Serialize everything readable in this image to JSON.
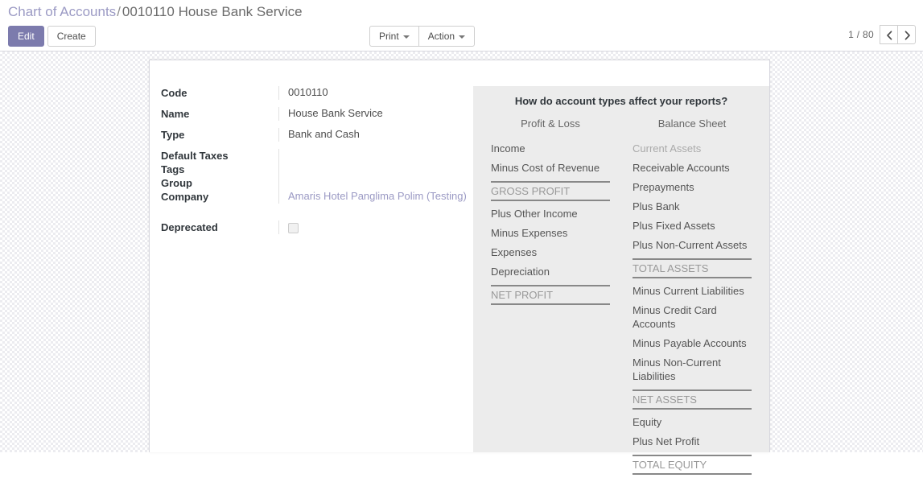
{
  "breadcrumb": {
    "root": "Chart of Accounts",
    "separator": "/",
    "current": "0010110 House Bank Service"
  },
  "toolbar": {
    "edit_label": "Edit",
    "create_label": "Create",
    "print_label": "Print",
    "action_label": "Action",
    "pager_count": "1 / 80",
    "previous_icon": "chevron-left-icon",
    "next_icon": "chevron-right-icon"
  },
  "form": {
    "fields": [
      {
        "label": "Code",
        "value": "0010110"
      },
      {
        "label": "Name",
        "value": "House Bank Service"
      },
      {
        "label": "Type",
        "value": "Bank and Cash"
      },
      {
        "label": "Default Taxes",
        "value": ""
      },
      {
        "label": "Tags",
        "value": ""
      },
      {
        "label": "Group",
        "value": ""
      },
      {
        "label": "Company",
        "value": "Amaris Hotel Panglima Polim (Testing)"
      },
      {
        "label": "Deprecated",
        "value": ""
      }
    ]
  },
  "info_panel": {
    "title": "How do account types affect your reports?",
    "columns": [
      {
        "heading": "Profit & Loss",
        "entries": [
          {
            "label": "Income",
            "style": "normal"
          },
          {
            "label": "Minus Cost of Revenue",
            "style": "normal"
          },
          {
            "label": "GROSS PROFIT",
            "style": "total"
          },
          {
            "label": "Plus Other Income",
            "style": "normal"
          },
          {
            "label": "Minus Expenses",
            "style": "normal"
          },
          {
            "label": "Expenses",
            "style": "normal"
          },
          {
            "label": "Depreciation",
            "style": "normal"
          },
          {
            "label": "NET PROFIT",
            "style": "total"
          }
        ]
      },
      {
        "heading": "Balance Sheet",
        "entries": [
          {
            "label": "Current Assets",
            "style": "muted"
          },
          {
            "label": "Receivable Accounts",
            "style": "normal"
          },
          {
            "label": "Prepayments",
            "style": "normal"
          },
          {
            "label": "Plus Bank",
            "style": "normal"
          },
          {
            "label": "Plus Fixed Assets",
            "style": "normal"
          },
          {
            "label": "Plus Non-Current Assets",
            "style": "normal"
          },
          {
            "label": "TOTAL ASSETS",
            "style": "total"
          },
          {
            "label": "Minus Current Liabilities",
            "style": "normal"
          },
          {
            "label": "Minus Credit Card Accounts",
            "style": "normal"
          },
          {
            "label": "Minus Payable Accounts",
            "style": "normal"
          },
          {
            "label": "Minus Non-Current Liabilities",
            "style": "normal"
          },
          {
            "label": "NET ASSETS",
            "style": "total"
          },
          {
            "label": "Equity",
            "style": "normal"
          },
          {
            "label": "Plus Net Profit",
            "style": "normal"
          },
          {
            "label": "TOTAL EQUITY",
            "style": "total"
          }
        ]
      }
    ]
  },
  "colors": {
    "accent": "#7c7bad",
    "link": "#9b9ac4",
    "panel_bg": "#ececec"
  }
}
